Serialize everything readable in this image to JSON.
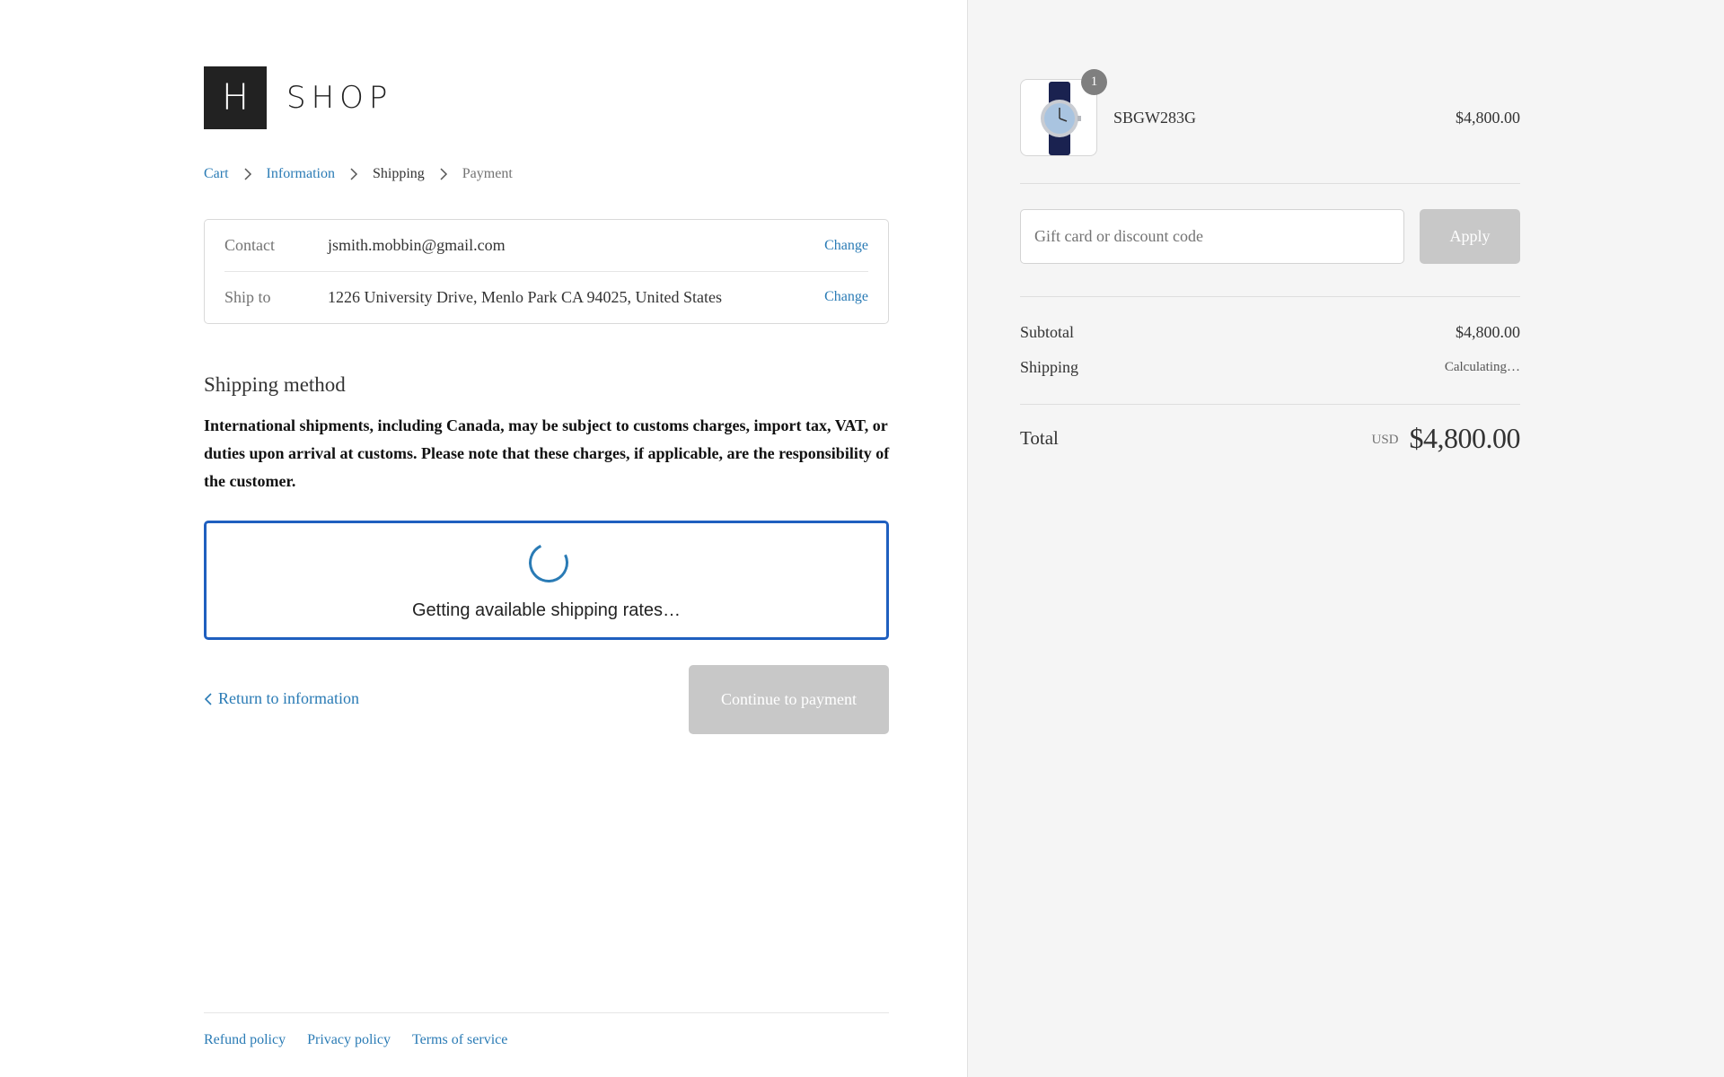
{
  "brand": {
    "logo_letter": "H",
    "logo_text": "SHOP"
  },
  "breadcrumb": {
    "cart": "Cart",
    "information": "Information",
    "shipping": "Shipping",
    "payment": "Payment"
  },
  "review": {
    "contact_label": "Contact",
    "contact_value": "jsmith.mobbin@gmail.com",
    "shipto_label": "Ship to",
    "shipto_value": "1226 University Drive, Menlo Park CA 94025, United States",
    "change_label": "Change"
  },
  "shipping": {
    "title": "Shipping method",
    "notice": "International shipments, including Canada, may be subject to customs charges, import tax, VAT, or duties upon arrival at customs. Please note that these charges, if applicable, are the responsibility of the customer.",
    "loading_text": "Getting available shipping rates…"
  },
  "actions": {
    "return_label": "Return to information",
    "continue_label": "Continue to payment"
  },
  "footer": {
    "refund": "Refund policy",
    "privacy": "Privacy policy",
    "terms": "Terms of service"
  },
  "summary": {
    "product": {
      "name": "SBGW283G",
      "price": "$4,800.00",
      "quantity": "1",
      "image_icon": "watch-icon"
    },
    "discount": {
      "placeholder": "Gift card or discount code",
      "apply_label": "Apply"
    },
    "subtotal_label": "Subtotal",
    "subtotal_value": "$4,800.00",
    "shipping_label": "Shipping",
    "shipping_value": "Calculating…",
    "total_label": "Total",
    "currency": "USD",
    "total_value": "$4,800.00"
  },
  "colors": {
    "link": "#2a7bb5",
    "focus_border": "#1f5fbf",
    "disabled_button": "#c8c8c8",
    "sidebar_bg": "#f5f5f5"
  }
}
